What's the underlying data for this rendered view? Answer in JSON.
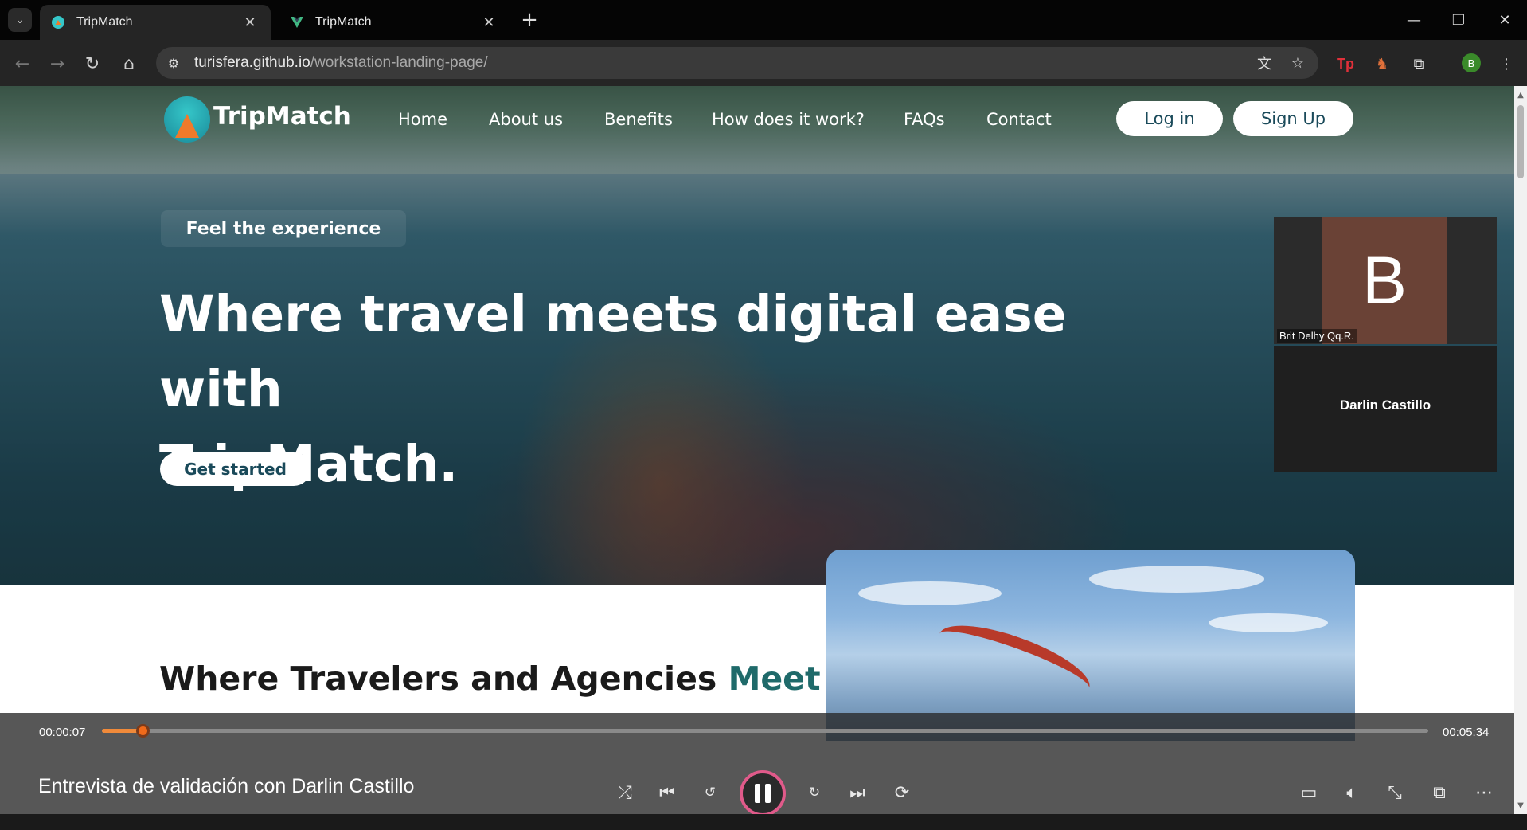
{
  "browser": {
    "tabs": [
      {
        "title": "TripMatch",
        "active": true
      },
      {
        "title": "TripMatch",
        "active": false
      }
    ],
    "url_host": "turisfera.github.io",
    "url_path": "/workstation-landing-page/",
    "profile_initial": "B",
    "colors": {
      "tabbar": "#050505",
      "toolbar": "#252525",
      "omnibox": "#3a3a3a"
    }
  },
  "site": {
    "brand": "TripMatch",
    "nav": [
      "Home",
      "About us",
      "Benefits",
      "How does it work?",
      "FAQs",
      "Contact"
    ],
    "login_label": "Log in",
    "signup_label": "Sign Up",
    "tagline": "Feel the experience",
    "headline_line1": "Where travel meets digital ease with",
    "headline_line2": "TripMatch.",
    "cta_label": "Get started",
    "section2_title": "Where Travelers and Agencies",
    "section2_accent": "Meet",
    "colors": {
      "brand_teal": "#1f6a6a",
      "logo_orange": "#f07a2a",
      "logo_teal": "#35c6c8"
    }
  },
  "call": {
    "participants": [
      {
        "name": "Brit Delhy Qq.R.",
        "avatar_initial": "B"
      },
      {
        "name": "Darlin Castillo"
      }
    ]
  },
  "player": {
    "title": "Entrevista de validación con Darlin Castillo",
    "current_time": "00:00:07",
    "total_time": "00:05:34",
    "progress_fraction": 0.021,
    "accent": "#f06a1a",
    "controls": [
      "shuffle-icon",
      "previous-icon",
      "rewind-10-icon",
      "pause-icon",
      "forward-30-icon",
      "next-icon",
      "repeat-icon",
      "captions-icon",
      "volume-icon",
      "minimize-icon",
      "miniplayer-icon",
      "more-icon"
    ]
  }
}
